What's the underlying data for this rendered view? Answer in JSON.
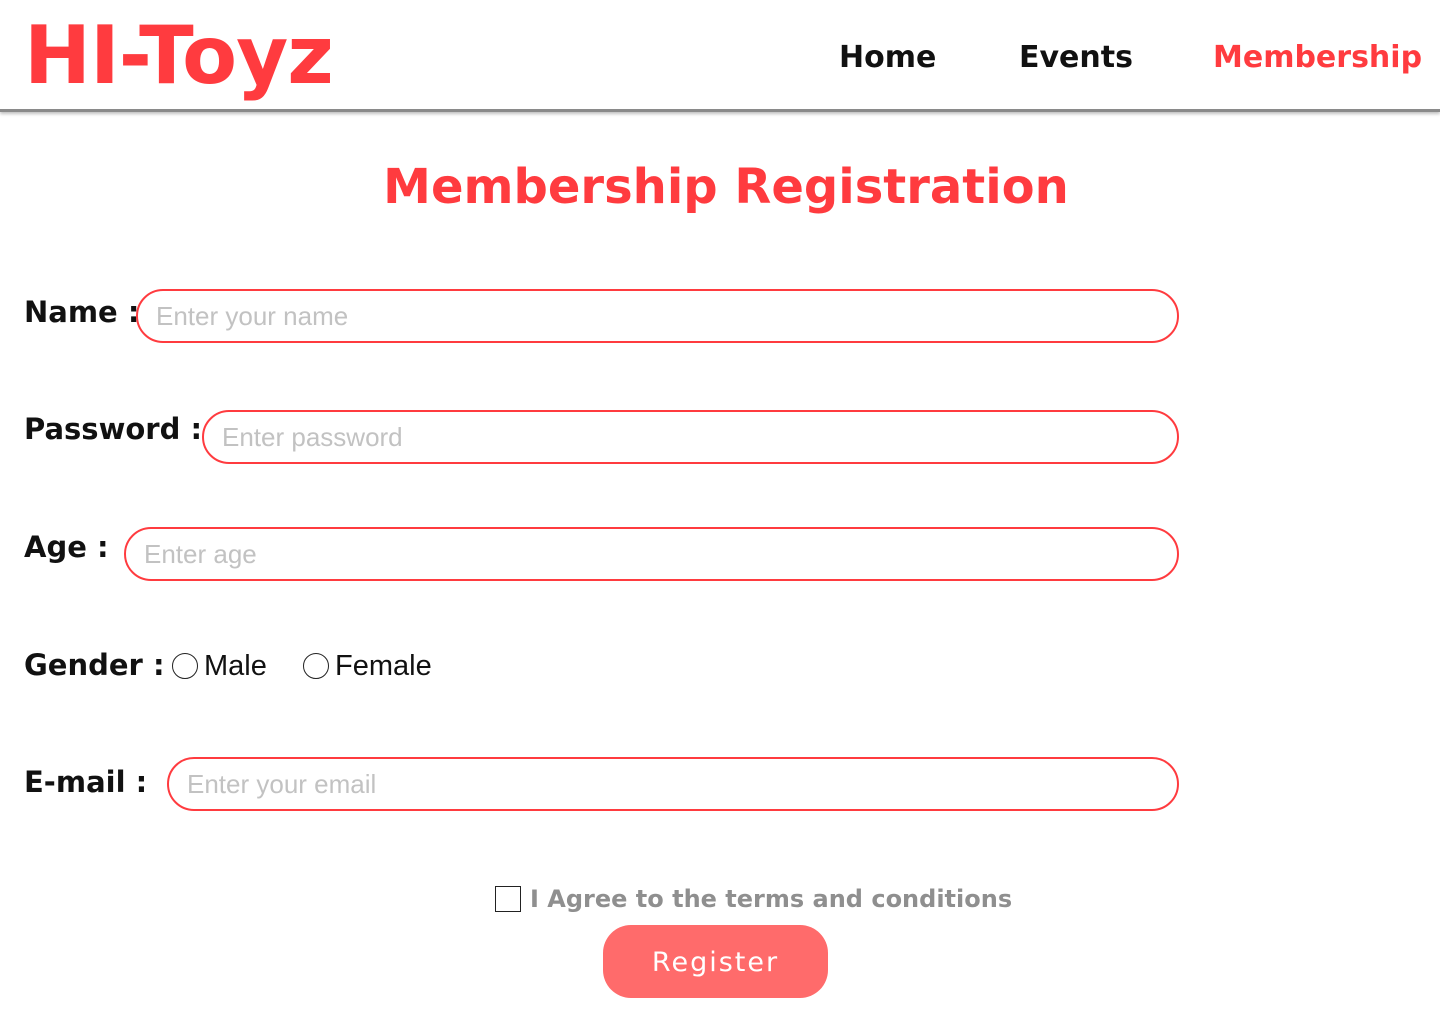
{
  "header": {
    "logo": "HI-Toyz",
    "nav": {
      "home": "Home",
      "events": "Events",
      "membership": "Membership"
    }
  },
  "page": {
    "title": "Membership Registration"
  },
  "form": {
    "name": {
      "label": "Name :",
      "placeholder": "Enter your name",
      "value": ""
    },
    "password": {
      "label": "Password :",
      "placeholder": "Enter password",
      "value": ""
    },
    "age": {
      "label": "Age :",
      "placeholder": "Enter age",
      "value": ""
    },
    "gender": {
      "label": "Gender :",
      "options": [
        "Male",
        "Female"
      ],
      "selected": ""
    },
    "email": {
      "label": "E-mail :",
      "placeholder": "Enter your email",
      "value": ""
    },
    "terms": {
      "label": "I Agree to the terms and conditions",
      "checked": false
    },
    "register_label": "Register"
  },
  "colors": {
    "brand": "#ff3b3f",
    "button": "#ff6b6b",
    "muted_text": "#8f8f8f",
    "placeholder": "#c2c2c2"
  }
}
